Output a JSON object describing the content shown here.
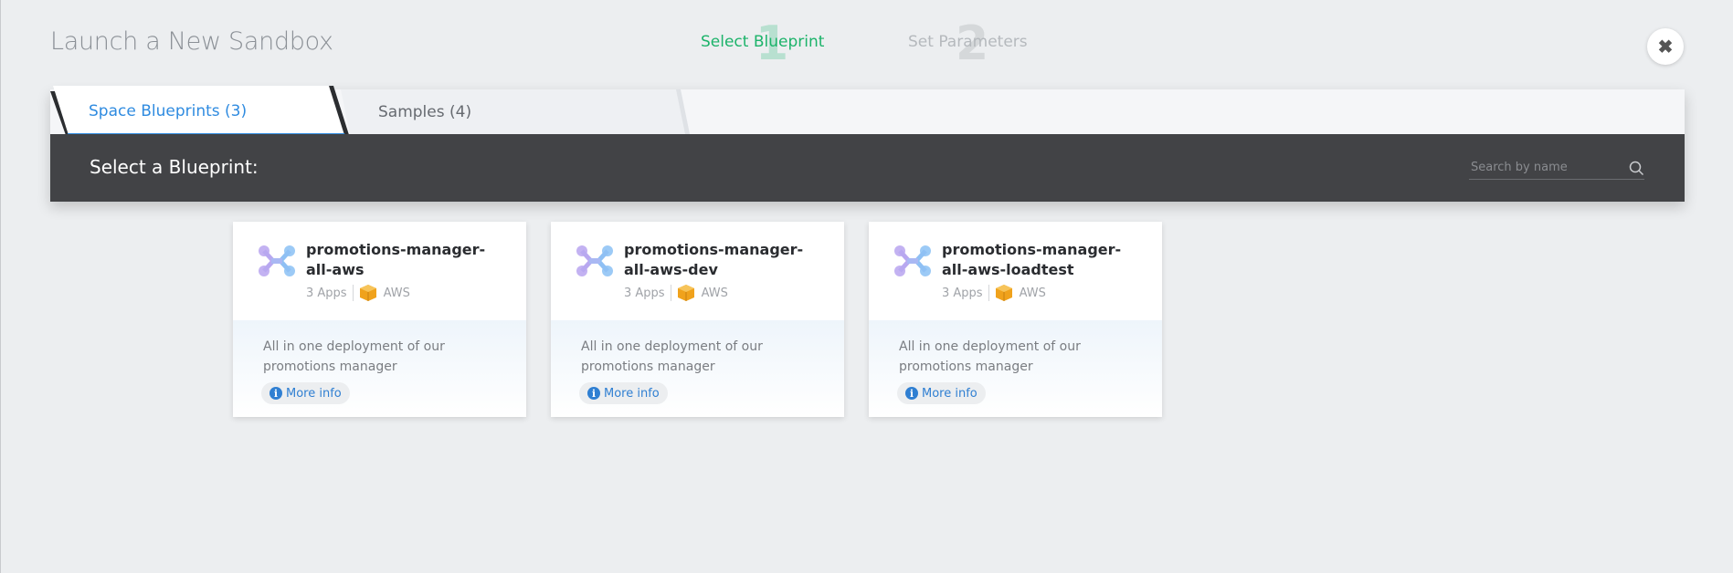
{
  "header": {
    "title": "Launch a New Sandbox",
    "steps": [
      {
        "number": "1",
        "label": "Select Blueprint",
        "state": "active"
      },
      {
        "number": "2",
        "label": "Set Parameters",
        "state": "inactive"
      }
    ],
    "close_icon": "close-icon"
  },
  "tabs": [
    {
      "label": "Space Blueprints (3)",
      "active": true
    },
    {
      "label": "Samples (4)",
      "active": false
    }
  ],
  "toolbar": {
    "heading": "Select a Blueprint:",
    "search_placeholder": "Search by name"
  },
  "cards": [
    {
      "name": "promotions-manager-all-aws",
      "apps": "3 Apps",
      "provider": "AWS",
      "description": "All in one deployment of our promotions manager",
      "more_label": "More info"
    },
    {
      "name": "promotions-manager-all-aws-dev",
      "apps": "3 Apps",
      "provider": "AWS",
      "description": "All in one deployment of our promotions manager",
      "more_label": "More info"
    },
    {
      "name": "promotions-manager-all-aws-loadtest",
      "apps": "3 Apps",
      "provider": "AWS",
      "description": "All in one deployment of our promotions manager",
      "more_label": "More info"
    }
  ],
  "colors": {
    "accent": "#2f8be0",
    "active_step": "#1cb36a",
    "dark_bar": "#424346",
    "aws": "#f0a21c"
  }
}
